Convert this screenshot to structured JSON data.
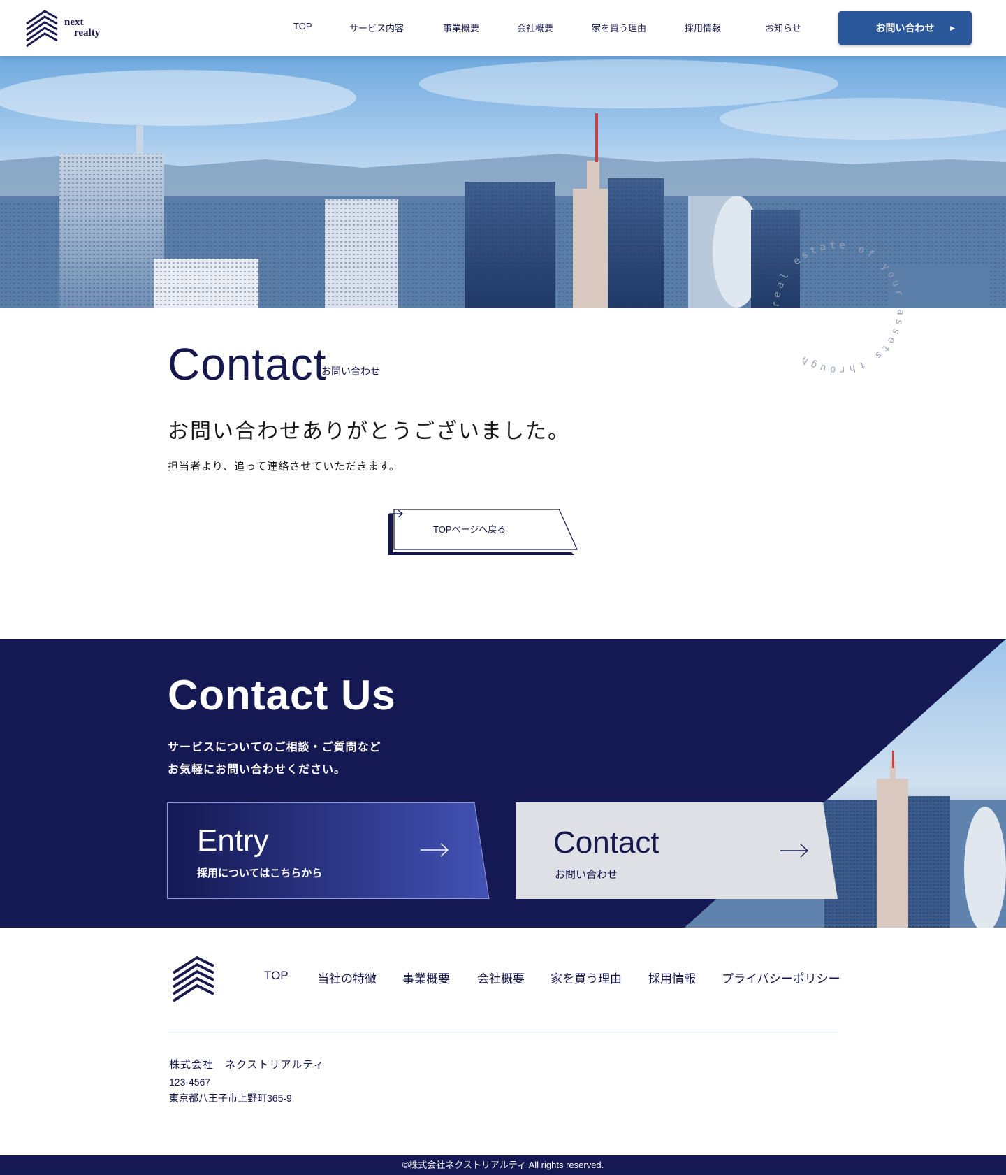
{
  "header": {
    "logo_line1": "next",
    "logo_line2": "realty",
    "nav": [
      "TOP",
      "サービス内容",
      "事業概要",
      "会社概要",
      "家を買う理由",
      "採用情報",
      "お知らせ"
    ],
    "cta_label": "お問い合わせ"
  },
  "hero": {
    "circular_text": "real estate of your assets through "
  },
  "contact": {
    "title": "Contact",
    "subtitle": "お問い合わせ",
    "thanks": "お問い合わせありがとうございました。",
    "followup": "担当者より、追って連絡させていただきます。",
    "back_button": "TOPページへ戻る"
  },
  "contact_us": {
    "title": "Contact Us",
    "desc_line1": "サービスについてのご相談・ご質問など",
    "desc_line2": "お気軽にお問い合わせください。",
    "entry_title": "Entry",
    "entry_sub": "採用についてはこちらから",
    "contact_title": "Contact",
    "contact_sub": "お問い合わせ"
  },
  "footer": {
    "nav": [
      "TOP",
      "当社の特徴",
      "事業概要",
      "会社概要",
      "家を買う理由",
      "採用情報",
      "プライバシーポリシー"
    ],
    "company": "株式会社　ネクストリアルティ",
    "zip": "123-4567",
    "address": "東京都八王子市上野町365-9",
    "copyright": "©株式会社ネクストリアルティ All rights reserved."
  },
  "colors": {
    "navy": "#141853",
    "cta_blue": "#2a5799",
    "entry_gradient_end": "#4050b0",
    "contact_card_bg": "#dfe0e6"
  }
}
